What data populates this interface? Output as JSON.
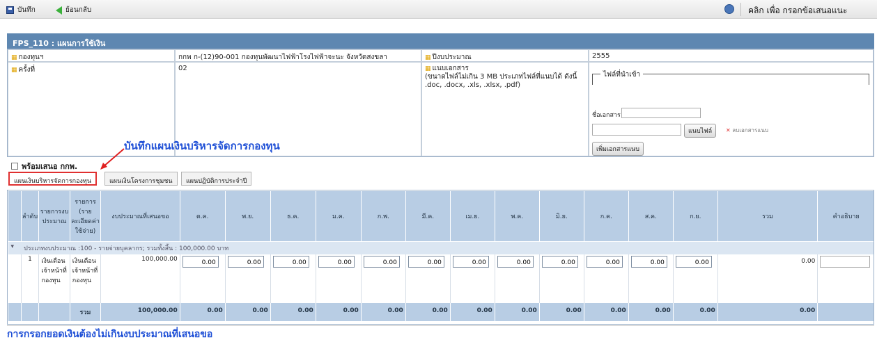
{
  "toolbar": {
    "save_label": "บันทึก",
    "back_label": "ย้อนกลับ",
    "help_label": "คลิก เพื่อ กรอกข้อเสนอแนะ"
  },
  "panel": {
    "title": "FPS_110 : แผนการใช้เงิน"
  },
  "info": {
    "fund_label": "กองทุนฯ",
    "fund_value": "กกพ ก-(12)90-001 กองทุนพัฒนาไฟฟ้าโรงไฟฟ้าจะนะ จังหวัดสงขลา",
    "year_label": "ปีงบประมาณ",
    "year_value": "2555",
    "round_label": "ครั้งที่",
    "round_value": "02",
    "attach_label": "แนบเอกสาร",
    "attach_note": "(ขนาดไฟล์ไม่เกิน 3 MB ประเภทไฟล์ที่แนบได้ ดังนี้ .doc, .docx, .xls, .xlsx, .pdf)",
    "imported_files_label": "ไฟล์ที่นำเข้า",
    "doc_name_label": "ชื่อเอกสาร",
    "attach_file_button": "แนบไฟล์",
    "delete_attach_label": "ลบเอกสารแนบ",
    "add_attach_button": "เพิ่มเอกสารแนบ"
  },
  "annotations": {
    "top": "บันทึกแผนเงินบริหารจัดการกองทุน",
    "bottom": "การกรอกยอดเงินต้องไม่เกินงบประมาณที่เสนอขอ"
  },
  "ready_checkbox": {
    "label": "พร้อมเสนอ กกพ."
  },
  "tabs": [
    {
      "label": "แผนเงินบริหารจัดการกองทุน",
      "active": true
    },
    {
      "label": "แผนเงินโครงการชุมชน",
      "active": false
    },
    {
      "label": "แผนปฏิบัติการประจำปี",
      "active": false
    }
  ],
  "grid": {
    "headers": [
      "ลำดับ",
      "รายการงบประมาณ",
      "รายการ (รายละเอียดค่าใช้จ่าย)",
      "งบประมาณที่เสนอขอ",
      "ต.ค.",
      "พ.ย.",
      "ธ.ค.",
      "ม.ค.",
      "ก.พ.",
      "มี.ค.",
      "เม.ย.",
      "พ.ค.",
      "มิ.ย.",
      "ก.ค.",
      "ส.ค.",
      "ก.ย.",
      "รวม",
      "คำอธิบาย"
    ],
    "group_label": "ประเภทงบประมาณ :100 - รายจ่ายบุคลากร; รวมทั้งสิ้น : 100,000.00 บาท",
    "row": {
      "no": "1",
      "budget_item": "เงินเดือนเจ้าหน้าที่กองทุน",
      "detail": "เงินเดือนเจ้าหน้าที่กองทุน",
      "requested": "100,000.00",
      "months": [
        "0.00",
        "0.00",
        "0.00",
        "0.00",
        "0.00",
        "0.00",
        "0.00",
        "0.00",
        "0.00",
        "0.00",
        "0.00",
        "0.00"
      ],
      "total": "0.00"
    },
    "totals": {
      "label": "รวม",
      "requested": "100,000.00",
      "months": [
        "0.00",
        "0.00",
        "0.00",
        "0.00",
        "0.00",
        "0.00",
        "0.00",
        "0.00",
        "0.00",
        "0.00",
        "0.00",
        "0.00"
      ],
      "total": "0.00"
    }
  },
  "colors": {
    "header_bar": "#5e87b1",
    "grid_header": "#b8cde4",
    "annotation": "#1e4fd6",
    "active_tab_border": "#e03030"
  }
}
